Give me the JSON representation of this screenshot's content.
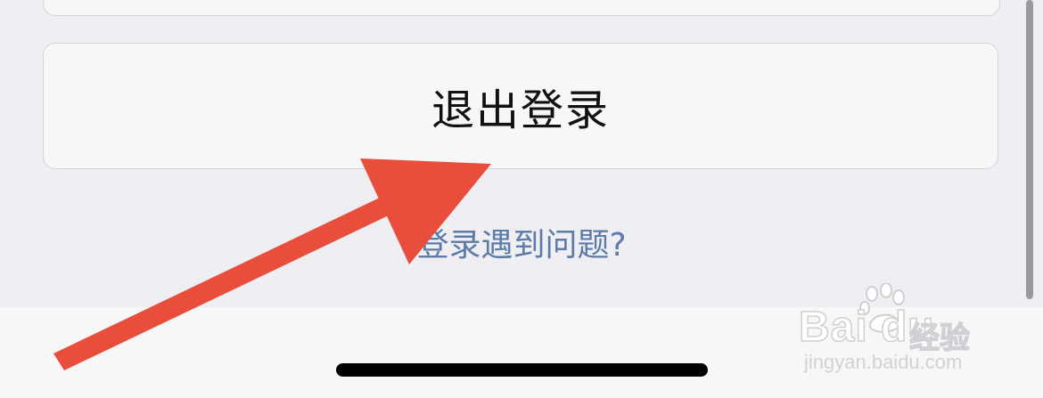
{
  "logout": {
    "label": "退出登录"
  },
  "help": {
    "label": "登录遇到问题?"
  },
  "watermark": {
    "brand": "Bai du",
    "product": "经验",
    "url": "jingyan.baidu.com"
  },
  "annotation": {
    "arrow_color": "#e94e3c",
    "icon": "arrow-icon"
  },
  "colors": {
    "background": "#efeef3",
    "card": "#f7f7f7",
    "link": "#5d7ba8",
    "home_indicator": "#000000"
  }
}
